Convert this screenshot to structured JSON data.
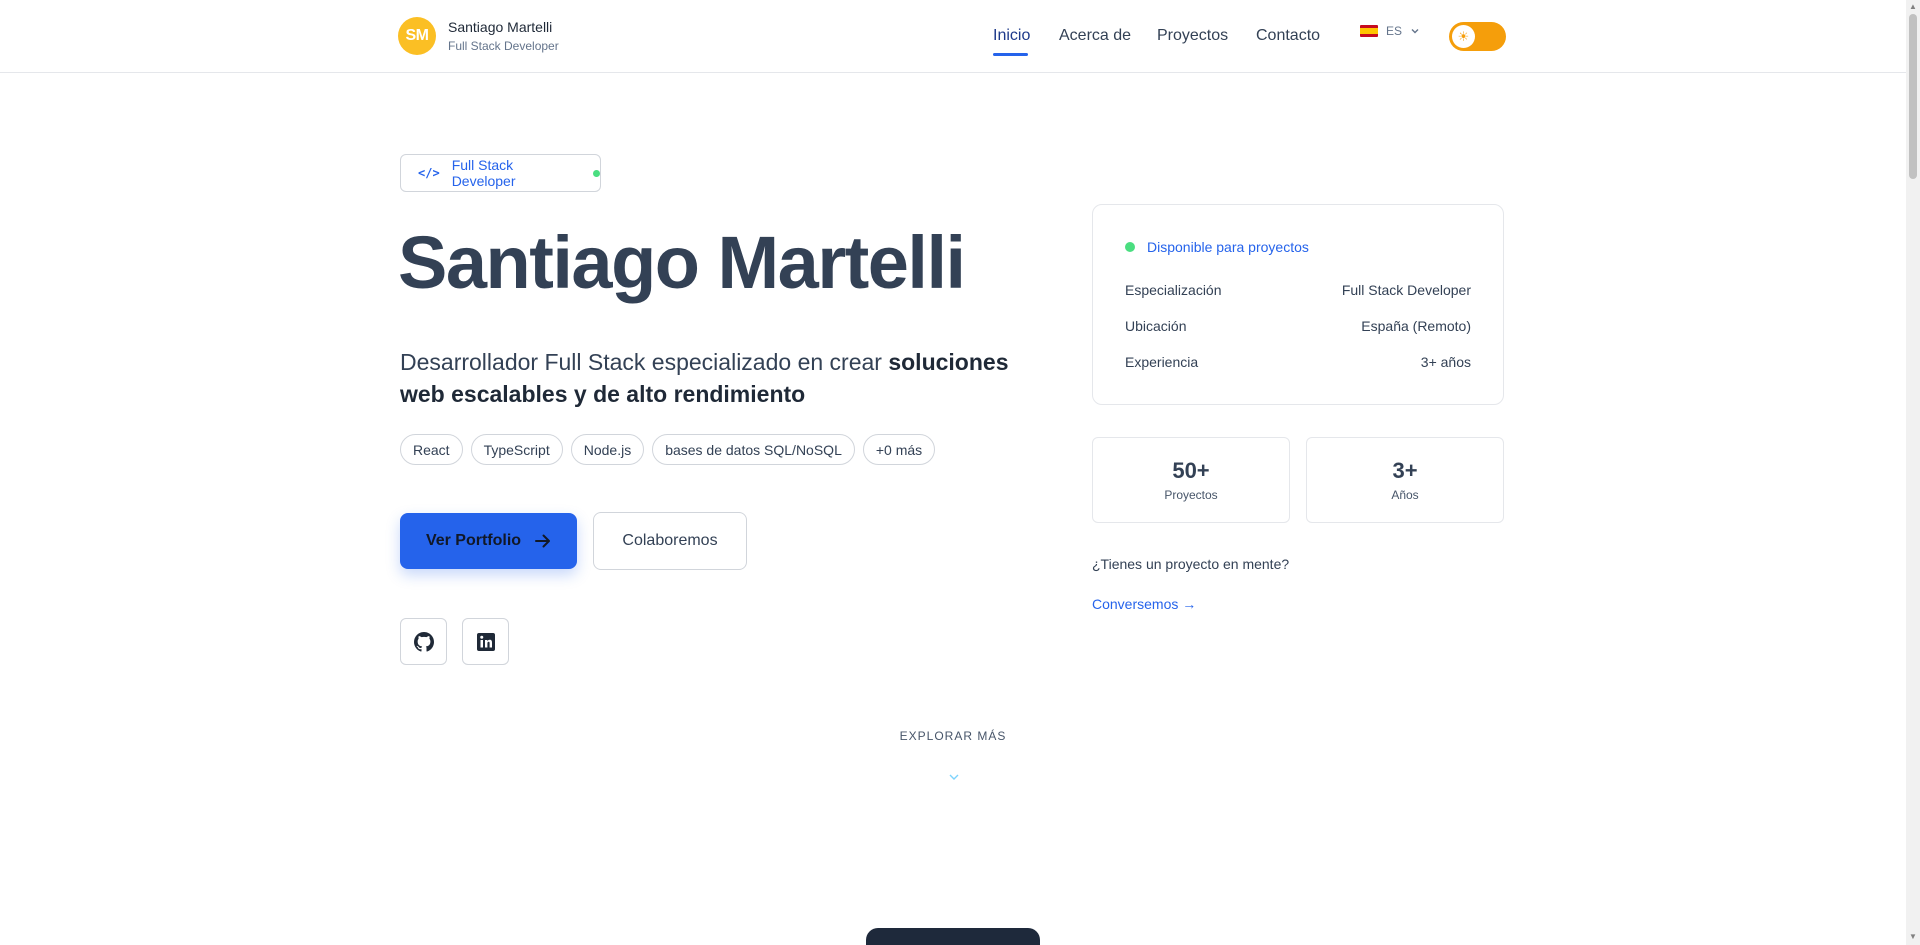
{
  "header": {
    "logo_initials": "SM",
    "name": "Santiago Martelli",
    "role": "Full Stack Developer",
    "nav": [
      "Inicio",
      "Acerca de",
      "Proyectos",
      "Contacto"
    ],
    "lang": "ES"
  },
  "hero": {
    "badge": "Full Stack Developer",
    "title": "Santiago Martelli",
    "desc_plain": "Desarrollador Full Stack especializado en crear ",
    "desc_bold": "soluciones web escalables y de alto rendimiento",
    "chips": [
      "React",
      "TypeScript",
      "Node.js",
      "bases de datos SQL/NoSQL",
      "+0 más"
    ],
    "primary_button": "Ver Portfolio",
    "secondary_button": "Colaboremos"
  },
  "card": {
    "availability": "Disponible para proyectos",
    "rows": [
      {
        "label": "Especialización",
        "value": "Full Stack Developer"
      },
      {
        "label": "Ubicación",
        "value": "España (Remoto)"
      },
      {
        "label": "Experiencia",
        "value": "3+ años"
      }
    ]
  },
  "stats": [
    {
      "num": "50+",
      "label": "Proyectos"
    },
    {
      "num": "3+",
      "label": "Años"
    }
  ],
  "cta": {
    "question": "¿Tienes un proyecto en mente?",
    "link": "Conversemos →"
  },
  "explore": "EXPLORAR MÁS",
  "colors": {
    "accent": "#2563eb",
    "toggle": "#f59e0b",
    "logo": "#fbbf24",
    "status": "#4ade80"
  }
}
